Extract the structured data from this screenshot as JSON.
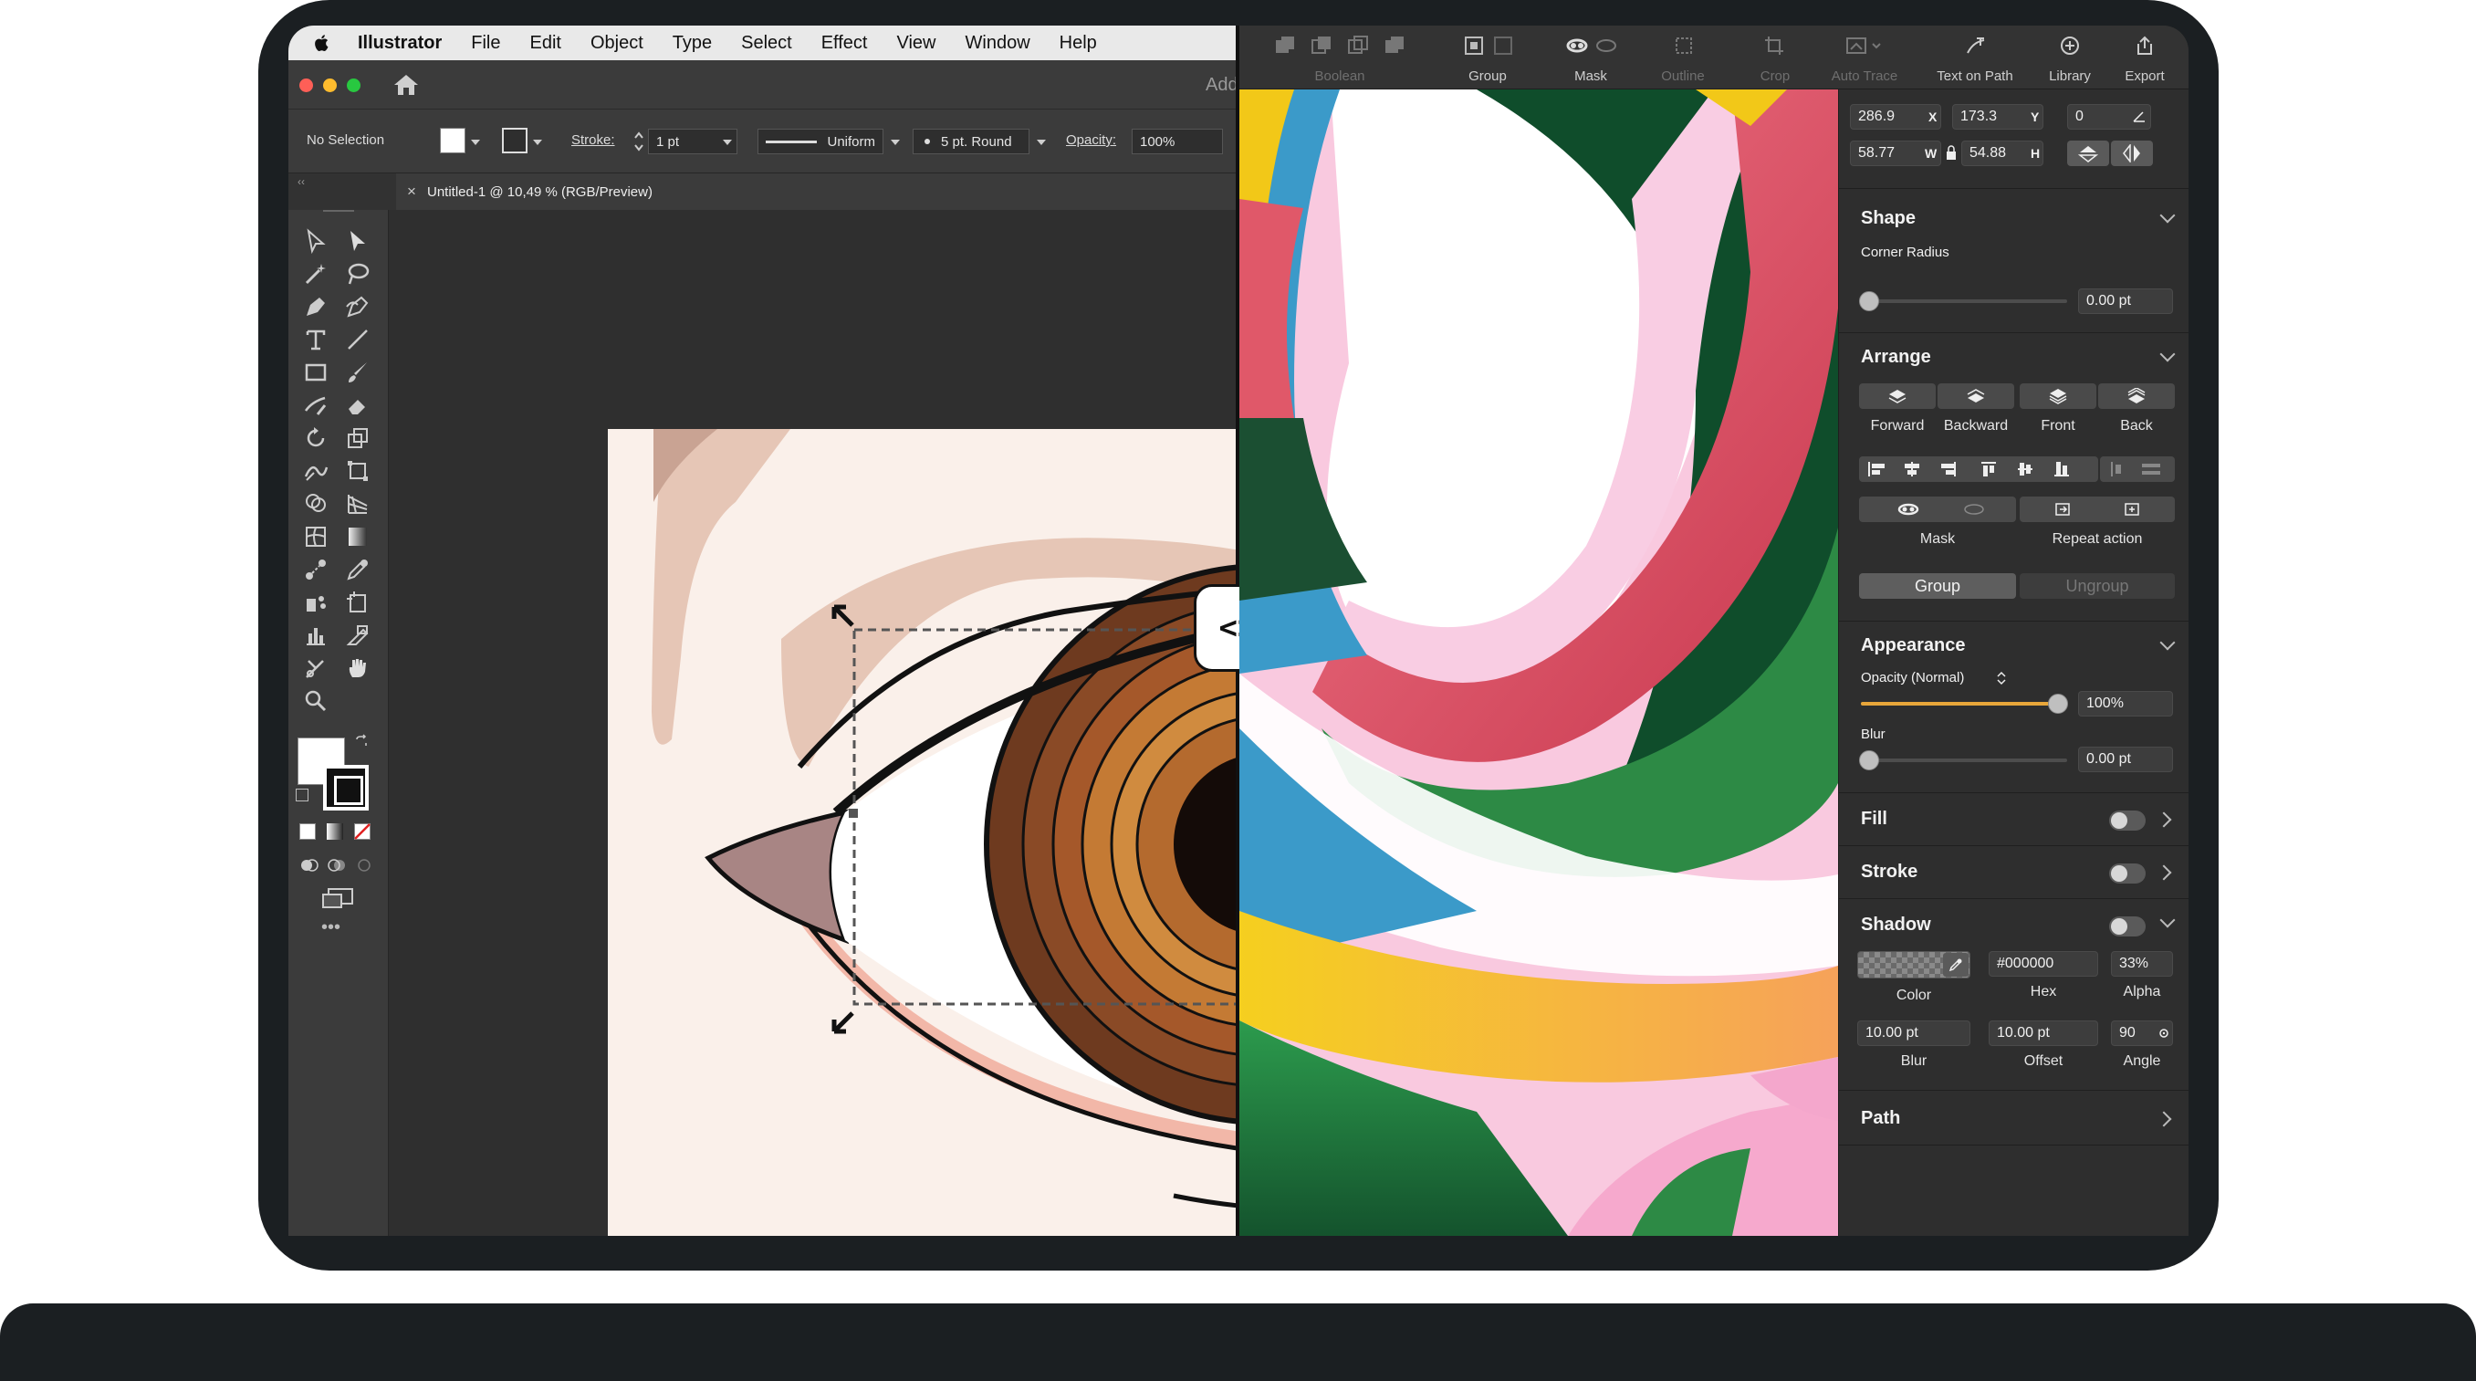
{
  "illustrator": {
    "menu": [
      "Illustrator",
      "File",
      "Edit",
      "Object",
      "Type",
      "Select",
      "Effect",
      "View",
      "Window",
      "Help"
    ],
    "title_truncated": "Add",
    "control": {
      "selection": "No Selection",
      "stroke_label": "Stroke:",
      "stroke_value": "1 pt",
      "profile": "Uniform",
      "brush": "5 pt. Round",
      "opacity_label": "Opacity:",
      "opacity_value": "100%"
    },
    "document_tab": "Untitled-1 @ 10,49 % (RGB/Preview)",
    "tools_more": "•••"
  },
  "divider": {
    "label": "<>"
  },
  "app": {
    "toolbar": {
      "boolean": "Boolean",
      "group": "Group",
      "mask": "Mask",
      "outline": "Outline",
      "crop": "Crop",
      "auto_trace": "Auto Trace",
      "text_on_path": "Text on Path",
      "library": "Library",
      "export": "Export"
    },
    "transform": {
      "x": "286.9",
      "x_label": "X",
      "y": "173.3",
      "y_label": "Y",
      "rotation": "0",
      "w": "58.77",
      "w_label": "W",
      "h": "54.88",
      "h_label": "H"
    },
    "shape": {
      "title": "Shape",
      "corner_radius_label": "Corner Radius",
      "corner_radius": "0.00 pt"
    },
    "arrange": {
      "title": "Arrange",
      "forward": "Forward",
      "backward": "Backward",
      "front": "Front",
      "back": "Back",
      "mask": "Mask",
      "repeat": "Repeat action",
      "group": "Group",
      "ungroup": "Ungroup"
    },
    "appearance": {
      "title": "Appearance",
      "opacity_label": "Opacity (Normal)",
      "opacity": "100%",
      "opacity_level": 1.0,
      "blur_label": "Blur",
      "blur": "0.00 pt"
    },
    "fill": {
      "title": "Fill"
    },
    "stroke": {
      "title": "Stroke"
    },
    "shadow": {
      "title": "Shadow",
      "hex": "#000000",
      "alpha": "33%",
      "color_label": "Color",
      "hex_label": "Hex",
      "alpha_label": "Alpha",
      "blur": "10.00 pt",
      "offset": "10.00 pt",
      "angle": "90",
      "blur_label": "Blur",
      "offset_label": "Offset",
      "angle_label": "Angle"
    },
    "path": {
      "title": "Path"
    }
  },
  "colors": {
    "accent_orange": "#e8a63a",
    "eye_brown_dark": "#6e3a1f",
    "eye_brown_mid": "#a5582a",
    "eye_brown_light": "#d08b3f",
    "skin": "#faf0ea",
    "brow": "#e5c3b2",
    "art_pink": "#f4a7cc",
    "art_red": "#e05869",
    "art_green": "#1f6b3c",
    "art_blue": "#3b9ac9",
    "art_yellow": "#f2c818"
  }
}
